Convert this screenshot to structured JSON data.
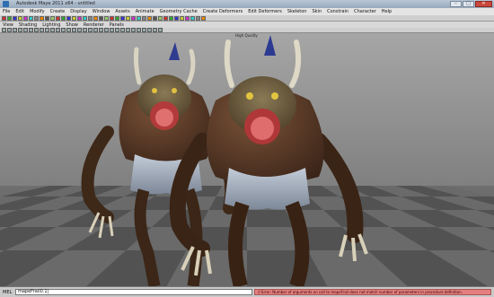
{
  "window": {
    "title": "Autodesk Maya 2011 x64 - untitled"
  },
  "menubar": {
    "items": [
      "File",
      "Edit",
      "Modify",
      "Create",
      "Display",
      "Window",
      "Assets",
      "Animate",
      "Geometry Cache",
      "Create Deformers",
      "Edit Deformers",
      "Skeleton",
      "Skin",
      "Constrain",
      "Character",
      "Help"
    ]
  },
  "panel_menu": {
    "items": [
      "View",
      "Shading",
      "Lighting",
      "Show",
      "Renderer",
      "Panels"
    ]
  },
  "viewport": {
    "hud_label": "High Quality"
  },
  "command_line": {
    "mel_label": "MEL",
    "input_value": "mapeFrail0.1|",
    "error_text": "// Error: Number of arguments on call to mapeFrail does not match number of parameters in procedure definition."
  },
  "colors": {
    "accent": "#2f6fb0",
    "error": "#e58080",
    "character_skin": "#5a3a2a",
    "shorts": "#aab6c6"
  }
}
